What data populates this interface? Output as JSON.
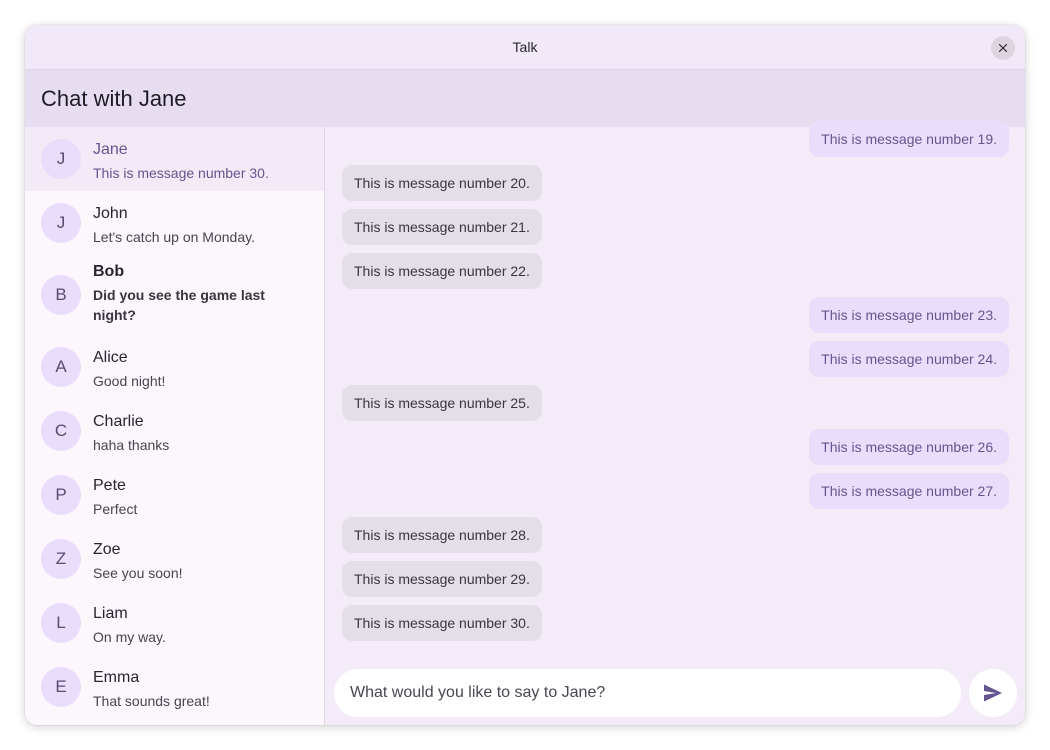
{
  "window": {
    "title": "Talk"
  },
  "header": {
    "title": "Chat with Jane"
  },
  "sidebar": {
    "conversations": [
      {
        "initial": "J",
        "name": "Jane",
        "preview": "This is message number 30.",
        "selected": true,
        "unread": false
      },
      {
        "initial": "J",
        "name": "John",
        "preview": "Let's catch up on Monday.",
        "selected": false,
        "unread": false
      },
      {
        "initial": "B",
        "name": "Bob",
        "preview": "Did you see the game last night?",
        "selected": false,
        "unread": true
      },
      {
        "initial": "A",
        "name": "Alice",
        "preview": "Good night!",
        "selected": false,
        "unread": false
      },
      {
        "initial": "C",
        "name": "Charlie",
        "preview": "haha thanks",
        "selected": false,
        "unread": false
      },
      {
        "initial": "P",
        "name": "Pete",
        "preview": "Perfect",
        "selected": false,
        "unread": false
      },
      {
        "initial": "Z",
        "name": "Zoe",
        "preview": "See you soon!",
        "selected": false,
        "unread": false
      },
      {
        "initial": "L",
        "name": "Liam",
        "preview": "On my way.",
        "selected": false,
        "unread": false
      },
      {
        "initial": "E",
        "name": "Emma",
        "preview": "That sounds great!",
        "selected": false,
        "unread": false
      }
    ]
  },
  "messages": [
    {
      "text": "This is message number 19.",
      "direction": "outgoing"
    },
    {
      "text": "This is message number 20.",
      "direction": "incoming"
    },
    {
      "text": "This is message number 21.",
      "direction": "incoming"
    },
    {
      "text": "This is message number 22.",
      "direction": "incoming"
    },
    {
      "text": "This is message number 23.",
      "direction": "outgoing"
    },
    {
      "text": "This is message number 24.",
      "direction": "outgoing"
    },
    {
      "text": "This is message number 25.",
      "direction": "incoming"
    },
    {
      "text": "This is message number 26.",
      "direction": "outgoing"
    },
    {
      "text": "This is message number 27.",
      "direction": "outgoing"
    },
    {
      "text": "This is message number 28.",
      "direction": "incoming"
    },
    {
      "text": "This is message number 29.",
      "direction": "incoming"
    },
    {
      "text": "This is message number 30.",
      "direction": "incoming"
    }
  ],
  "composer": {
    "placeholder": "What would you like to say to Jane?",
    "value": ""
  },
  "icons": {
    "close": "close-icon",
    "send": "send-icon"
  },
  "colors": {
    "accent": "#65558f",
    "outgoing_bubble": "#eadcfb",
    "incoming_bubble": "#e4dfe6",
    "avatar": "#eadcfb"
  }
}
